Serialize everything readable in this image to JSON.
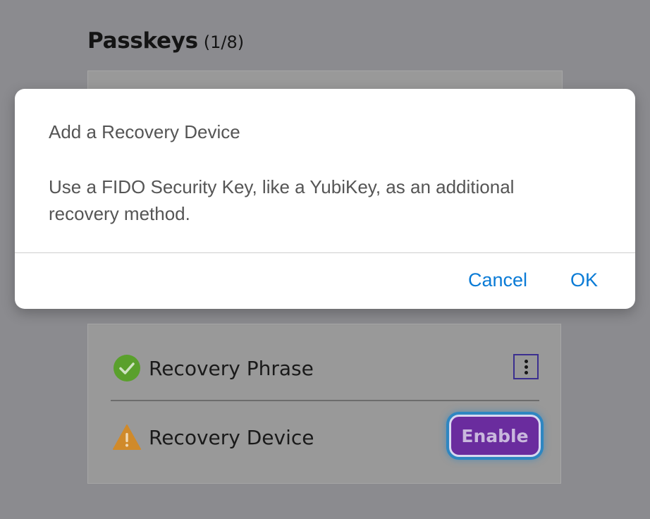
{
  "page": {
    "title": "Passkeys",
    "count": "(1/8)"
  },
  "recovery": {
    "phrase": {
      "label": "Recovery Phrase",
      "status": "enabled",
      "status_icon": "check-circle-icon",
      "status_color": "#5aa02c",
      "menu_icon": "more-vertical-icon"
    },
    "device": {
      "label": "Recovery Device",
      "status": "warning",
      "status_icon": "warning-triangle-icon",
      "status_color": "#d08a2a",
      "button_label": "Enable",
      "button_color": "#6a2c9e",
      "focus_ring_color": "#2e86c1"
    }
  },
  "dialog": {
    "title": "Add a Recovery Device",
    "message": "Use a FIDO Security Key, like a YubiKey, as an additional recovery method.",
    "cancel_label": "Cancel",
    "ok_label": "OK",
    "accent_color": "#0a7bd6"
  }
}
